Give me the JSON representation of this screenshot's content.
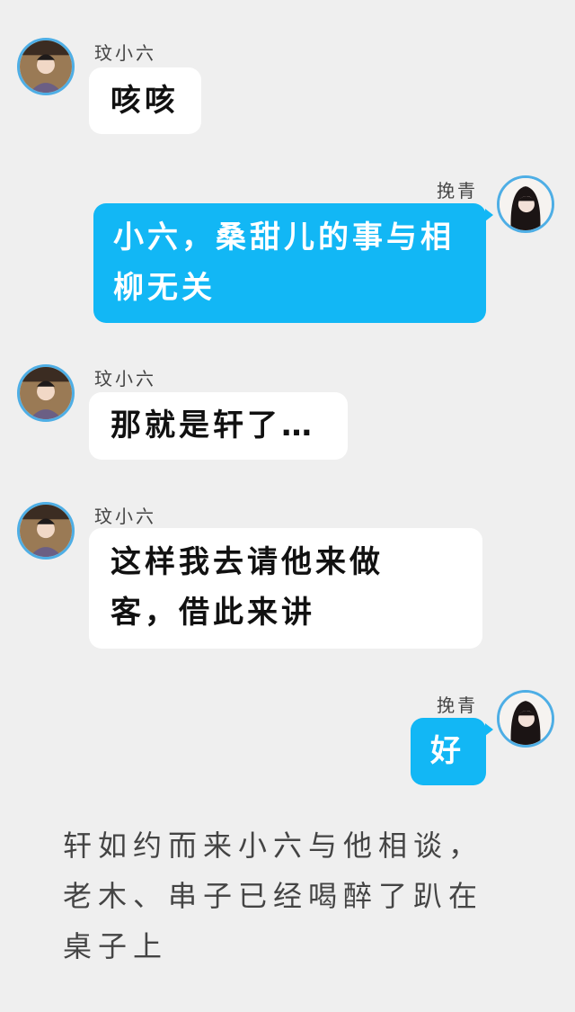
{
  "messages": [
    {
      "side": "left",
      "sender": "玟小六",
      "text": "咳咳"
    },
    {
      "side": "right",
      "sender": "挽青",
      "text": "小六，桑甜儿的事与相柳无关"
    },
    {
      "side": "left",
      "sender": "玟小六",
      "text": "那就是轩了…"
    },
    {
      "side": "left",
      "sender": "玟小六",
      "text": "这样我去请他来做客，借此来讲"
    },
    {
      "side": "right",
      "sender": "挽青",
      "text": "好"
    }
  ],
  "narration": "轩如约而来小六与他相谈，老木、串子已经喝醉了趴在桌子上",
  "colors": {
    "background": "#efefef",
    "right_bubble": "#12b7f5",
    "left_bubble": "#ffffff",
    "avatar_border": "#4eaee5"
  }
}
